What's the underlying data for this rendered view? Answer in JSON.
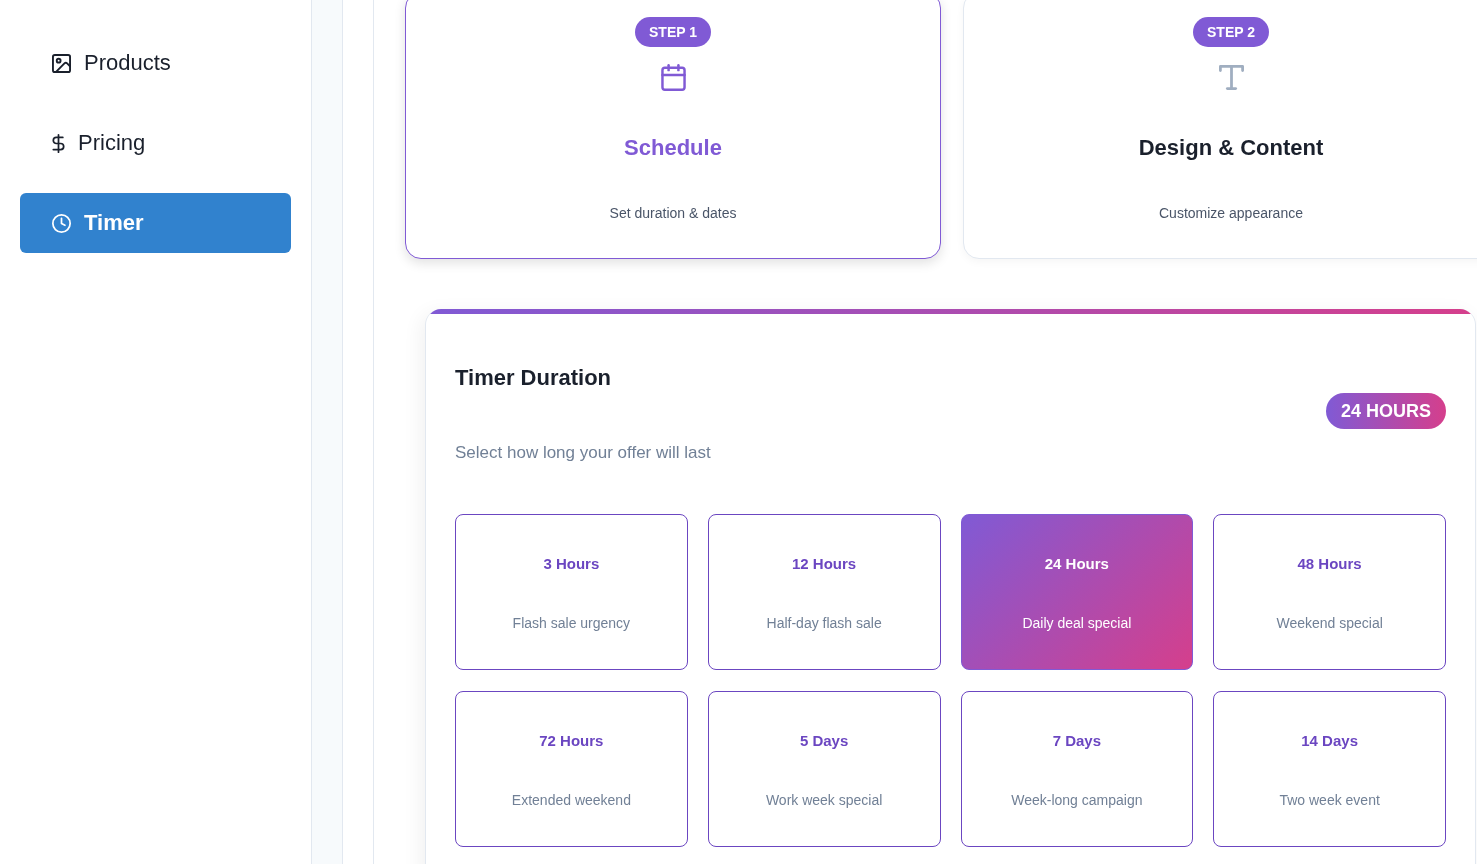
{
  "sidebar": {
    "items": [
      {
        "label": "Products",
        "selected": false
      },
      {
        "label": "Pricing",
        "selected": false
      },
      {
        "label": "Timer",
        "selected": true
      }
    ]
  },
  "steps": [
    {
      "badge": "STEP 1",
      "title": "Schedule",
      "subtitle": "Set duration & dates",
      "selected": true
    },
    {
      "badge": "STEP 2",
      "title": "Design & Content",
      "subtitle": "Customize appearance",
      "selected": false
    }
  ],
  "duration_panel": {
    "title": "Timer Duration",
    "subtitle": "Select how long your offer will last",
    "badge": "24 HOURS",
    "options": [
      {
        "label": "3 Hours",
        "description": "Flash sale urgency",
        "selected": false
      },
      {
        "label": "12 Hours",
        "description": "Half-day flash sale",
        "selected": false
      },
      {
        "label": "24 Hours",
        "description": "Daily deal special",
        "selected": true
      },
      {
        "label": "48 Hours",
        "description": "Weekend special",
        "selected": false
      },
      {
        "label": "72 Hours",
        "description": "Extended weekend",
        "selected": false
      },
      {
        "label": "5 Days",
        "description": "Work week special",
        "selected": false
      },
      {
        "label": "7 Days",
        "description": "Week-long campaign",
        "selected": false
      },
      {
        "label": "14 Days",
        "description": "Two week event",
        "selected": false
      }
    ]
  }
}
